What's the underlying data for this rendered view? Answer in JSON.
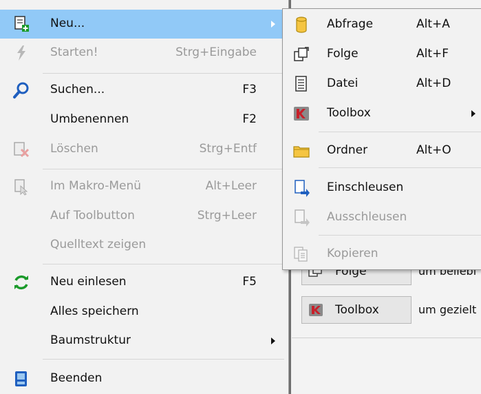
{
  "background": {
    "buttons": [
      {
        "label": "Folge",
        "desc": "um beliebi"
      },
      {
        "label": "Toolbox",
        "desc": "um gezielt"
      }
    ]
  },
  "main_menu": {
    "items": [
      {
        "label": "Neu...",
        "shortcut": "",
        "disabled": false,
        "icon": "new-document-icon"
      },
      {
        "label": "Starten!",
        "shortcut": "Strg+Eingabe",
        "disabled": true,
        "icon": "lightning-icon"
      },
      {
        "label": "Suchen...",
        "shortcut": "F3",
        "disabled": false,
        "icon": "search-icon"
      },
      {
        "label": "Umbenennen",
        "shortcut": "F2",
        "disabled": false,
        "icon": ""
      },
      {
        "label": "Löschen",
        "shortcut": "Strg+Entf",
        "disabled": true,
        "icon": "delete-icon"
      },
      {
        "label": "Im Makro-Menü",
        "shortcut": "Alt+Leer",
        "disabled": true,
        "icon": "macro-icon"
      },
      {
        "label": "Auf Toolbutton",
        "shortcut": "Strg+Leer",
        "disabled": true,
        "icon": ""
      },
      {
        "label": "Quelltext zeigen",
        "shortcut": "",
        "disabled": true,
        "icon": ""
      },
      {
        "label": "Neu einlesen",
        "shortcut": "F5",
        "disabled": false,
        "icon": "refresh-icon"
      },
      {
        "label": "Alles speichern",
        "shortcut": "",
        "disabled": false,
        "icon": ""
      },
      {
        "label": "Baumstruktur",
        "shortcut": "",
        "disabled": false,
        "icon": ""
      },
      {
        "label": "Beenden",
        "shortcut": "",
        "disabled": false,
        "icon": "exit-icon"
      }
    ]
  },
  "sub_menu": {
    "items": [
      {
        "label": "Abfrage",
        "shortcut": "Alt+A",
        "disabled": false,
        "icon": "query-icon"
      },
      {
        "label": "Folge",
        "shortcut": "Alt+F",
        "disabled": false,
        "icon": "sequence-icon"
      },
      {
        "label": "Datei",
        "shortcut": "Alt+D",
        "disabled": false,
        "icon": "file-icon"
      },
      {
        "label": "Toolbox",
        "shortcut": "",
        "disabled": false,
        "icon": "toolbox-icon"
      },
      {
        "label": "Ordner",
        "shortcut": "Alt+O",
        "disabled": false,
        "icon": "folder-icon"
      },
      {
        "label": "Einschleusen",
        "shortcut": "",
        "disabled": false,
        "icon": "import-icon"
      },
      {
        "label": "Ausschleusen",
        "shortcut": "",
        "disabled": true,
        "icon": "export-icon"
      },
      {
        "label": "Kopieren",
        "shortcut": "",
        "disabled": true,
        "icon": "copy-icon"
      }
    ]
  },
  "colors": {
    "highlight": "#91c9f7",
    "menu_bg": "#f2f2f2",
    "disabled_text": "#9a9a9a",
    "accent_blue": "#1f5fbf",
    "accent_green": "#1a9a2a",
    "accent_red": "#c8202a",
    "folder_yellow": "#f5c542"
  }
}
